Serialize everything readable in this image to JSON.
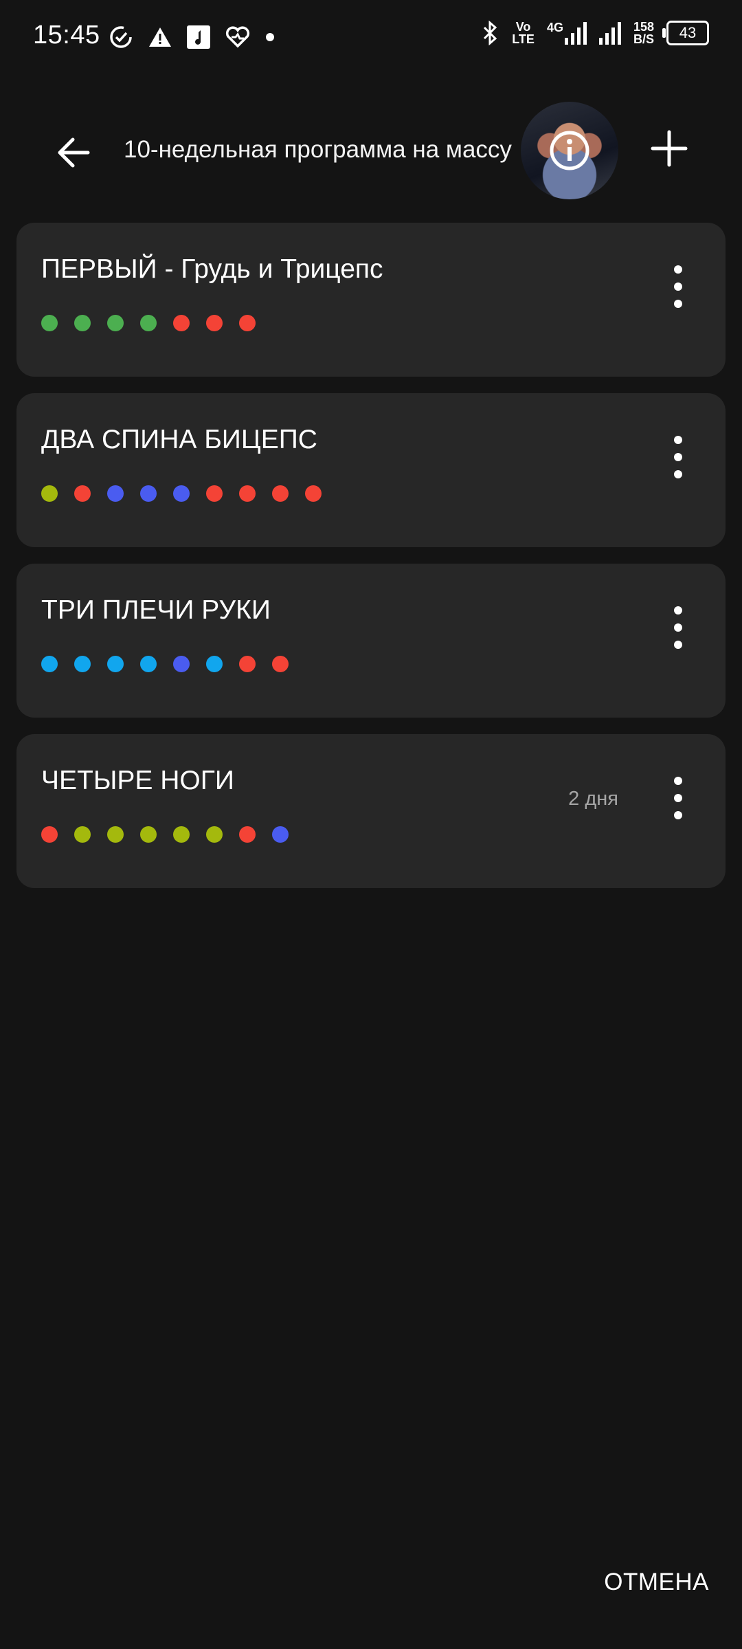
{
  "status_bar": {
    "time": "15:45",
    "left_icons": [
      "sync-check-icon",
      "alert-triangle-icon",
      "music-app-icon",
      "heart-health-icon",
      "dot-icon"
    ],
    "volte_top": "Vo",
    "volte_bottom": "LTE",
    "network": "4G",
    "speed_value": "158",
    "speed_unit": "B/S",
    "battery": "43"
  },
  "header": {
    "title": "10-недельная программа на массу",
    "back_icon": "arrow-left-icon",
    "info_icon": "info-icon",
    "add_icon": "plus-icon"
  },
  "workouts": [
    {
      "title": "ПЕРВЫЙ - Грудь и Трицепс",
      "meta": "",
      "dots": [
        "#4caf50",
        "#4caf50",
        "#4caf50",
        "#4caf50",
        "#f44336",
        "#f44336",
        "#f44336"
      ]
    },
    {
      "title": "ДВА СПИНА БИЦЕПС",
      "meta": "",
      "dots": [
        "#a4b90d",
        "#f44336",
        "#4a5cf0",
        "#4a5cf0",
        "#4a5cf0",
        "#f44336",
        "#f44336",
        "#f44336",
        "#f44336"
      ]
    },
    {
      "title": "ТРИ ПЛЕЧИ РУКИ",
      "meta": "",
      "dots": [
        "#11a6ee",
        "#11a6ee",
        "#11a6ee",
        "#11a6ee",
        "#4a5cf0",
        "#11a6ee",
        "#f44336",
        "#f44336"
      ]
    },
    {
      "title": "ЧЕТЫРЕ НОГИ",
      "meta": "2 дня",
      "dots": [
        "#f44336",
        "#a4b90d",
        "#a4b90d",
        "#a4b90d",
        "#a4b90d",
        "#a4b90d",
        "#f44336",
        "#4a5cf0"
      ]
    }
  ],
  "footer": {
    "cancel_label": "ОТМЕНА"
  }
}
